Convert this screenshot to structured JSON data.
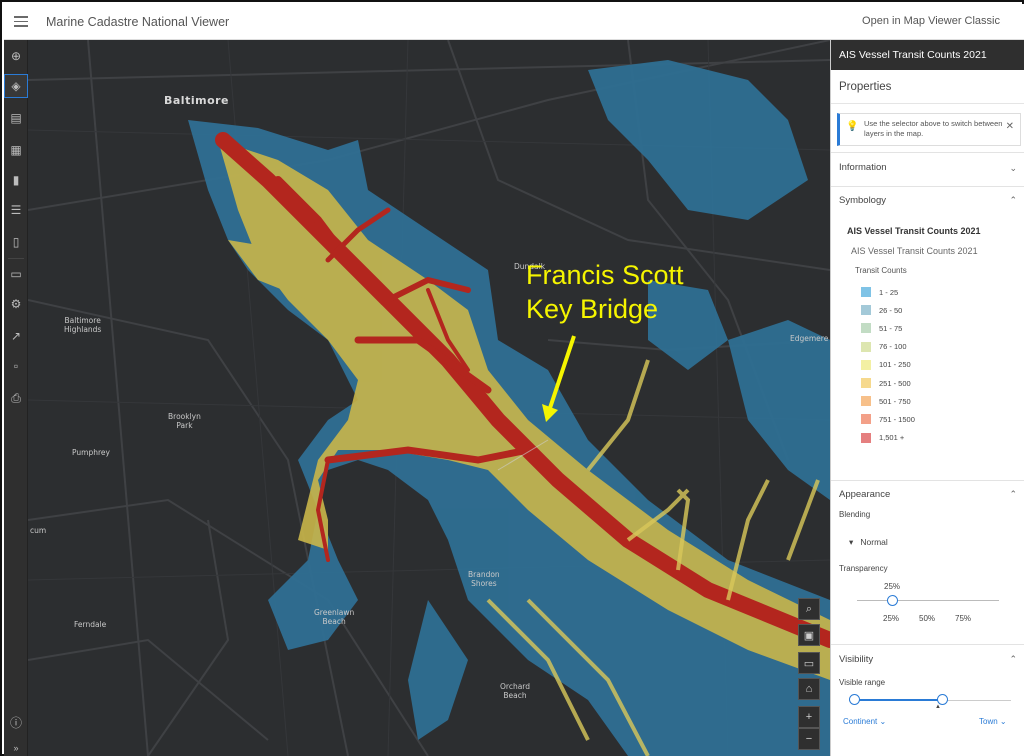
{
  "header": {
    "app_title": "Marine Cadastre National Viewer",
    "open_classic": "Open in Map Viewer Classic"
  },
  "toolbar": {
    "icons": [
      "add-icon",
      "layers-icon",
      "table-icon",
      "basemap-icon",
      "chart-icon",
      "legend-icon",
      "bookmark-icon",
      "sketch-icon",
      "settings-icon",
      "print-icon",
      "share-icon",
      "save-icon",
      "info-icon"
    ]
  },
  "map": {
    "labels": {
      "baltimore": "Baltimore",
      "baltimore_highlands": "Baltimore\nHighlands",
      "brooklyn_park": "Brooklyn\nPark",
      "pumphrey": "Pumphrey",
      "ferndale": "Ferndale",
      "greenlawn_beach": "Greenlawn\nBeach",
      "brandon_shores": "Brandon\nShores",
      "orchard_beach": "Orchard\nBeach",
      "dundalk": "Dundalk",
      "edgemere": "Edgemere",
      "cum": "cum"
    },
    "annotation": "Francis Scott\nKey Bridge",
    "annotation_color": "#f5f500",
    "controls": [
      "search-icon",
      "measure-icon",
      "screen-icon",
      "home-icon",
      "zoom-in-icon",
      "zoom-out-icon"
    ]
  },
  "panel": {
    "layer_title": "AIS Vessel Transit Counts 2021",
    "properties": "Properties",
    "notice": "Use the selector above to switch between layers in the map.",
    "information": "Information",
    "symbology": "Symbology",
    "symbology_layer": "AIS Vessel Transit Counts 2021",
    "symbology_sublayer": "AIS Vessel Transit Counts 2021",
    "field_label": "Transit Counts",
    "legend": [
      {
        "label": "1 - 25",
        "color": "#7fc3e6"
      },
      {
        "label": "26 - 50",
        "color": "#a3c9d8"
      },
      {
        "label": "51 - 75",
        "color": "#c2dcc4"
      },
      {
        "label": "76 - 100",
        "color": "#dde6b0"
      },
      {
        "label": "101 - 250",
        "color": "#f3f0a3"
      },
      {
        "label": "251 - 500",
        "color": "#f6d98d"
      },
      {
        "label": "501 - 750",
        "color": "#f7c08a"
      },
      {
        "label": "751 - 1500",
        "color": "#f3a088"
      },
      {
        "label": "1,501 +",
        "color": "#e57f7f"
      }
    ],
    "appearance": "Appearance",
    "blending": "Blending",
    "blending_value": "Normal",
    "transparency": "Transparency",
    "transparency_value": "25%",
    "transparency_value_fraction": 0.25,
    "transparency_ticks": [
      "25%",
      "50%",
      "75%"
    ],
    "visibility": "Visibility",
    "visible_range": "Visible range",
    "range_min": "Continent",
    "range_max": "Town"
  }
}
